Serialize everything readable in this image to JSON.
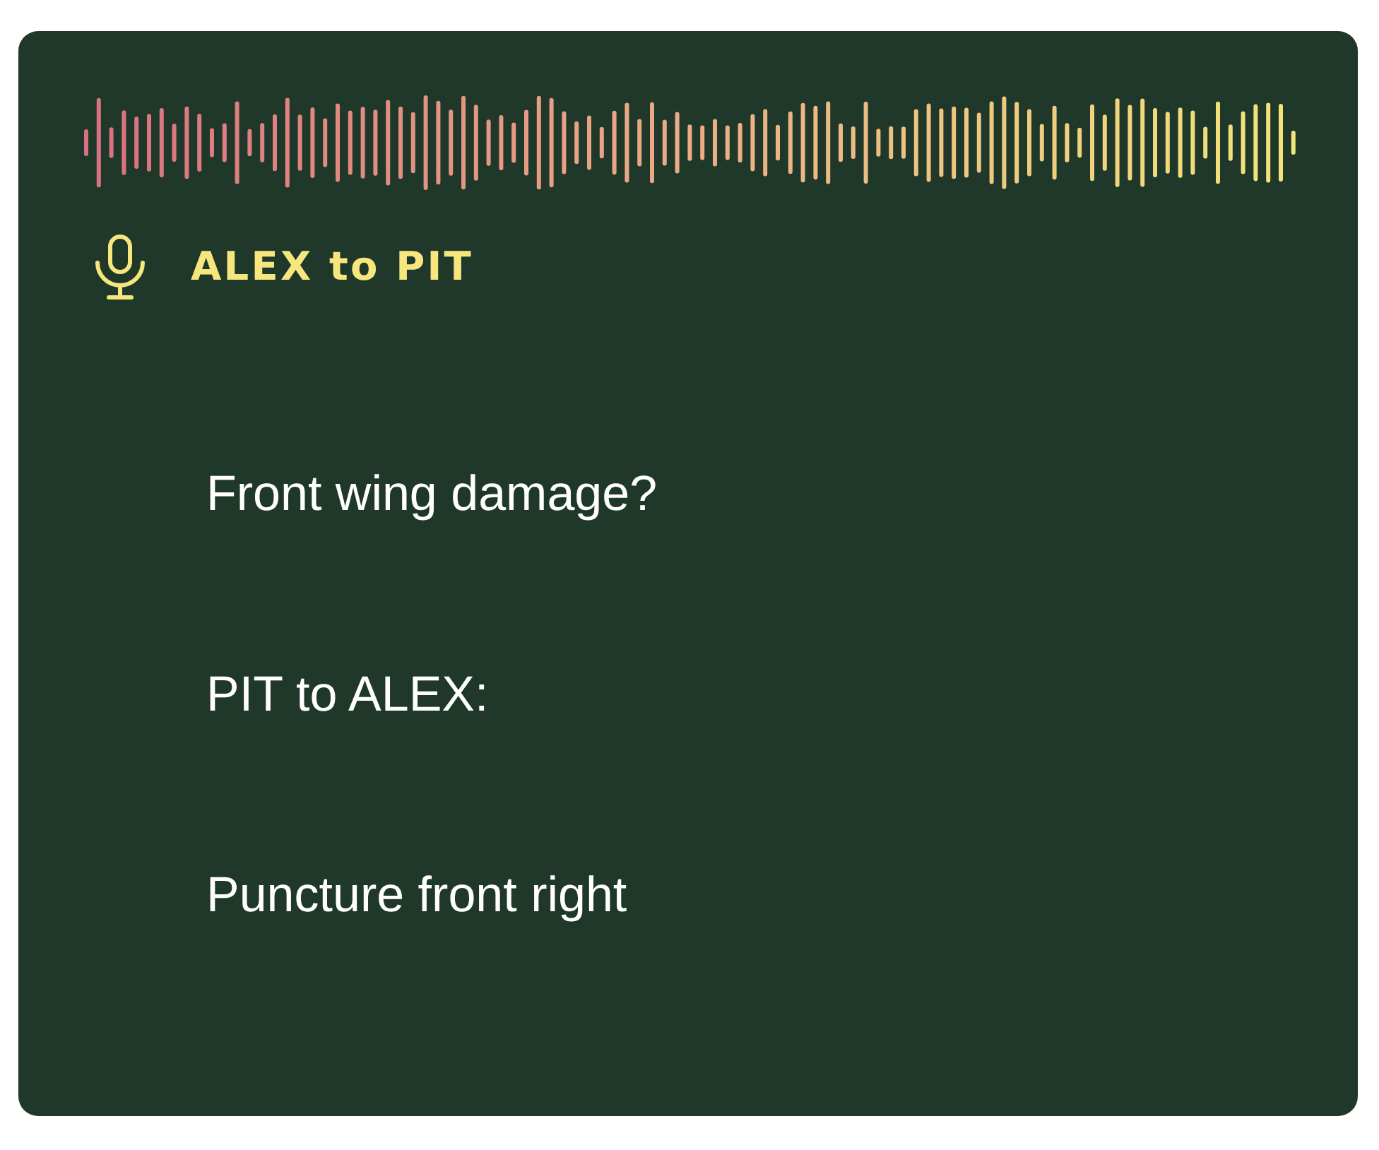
{
  "header": {
    "title": "ALEX to PIT"
  },
  "transcript_lines": [
    "Front wing damage?",
    "PIT to ALEX:",
    "Puncture front right"
  ]
}
